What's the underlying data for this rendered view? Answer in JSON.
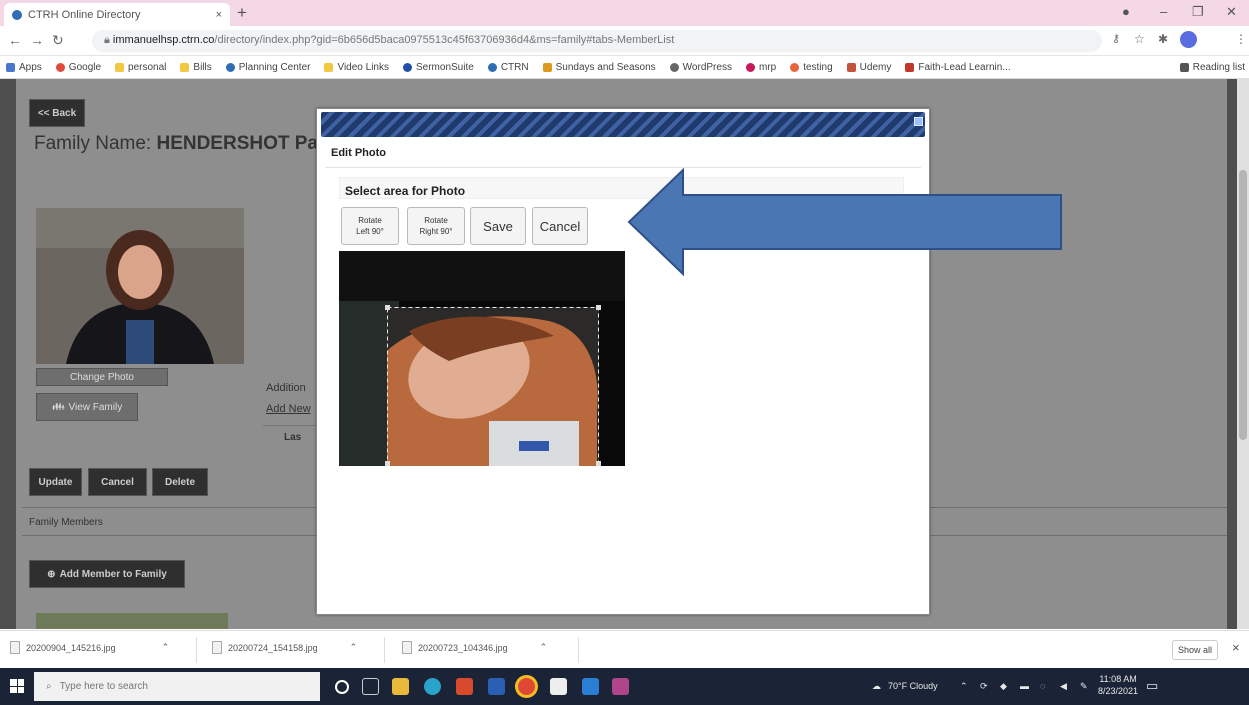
{
  "browser": {
    "tab_title": "CTRH Online Directory",
    "tab_close": "×",
    "new_tab": "+",
    "url_host": "immanuelhsp.ctrn.co",
    "url_path": "/directory/index.php?gid=6b656d5baca0975513c45f63706936d4&ms=family#tabs-MemberList",
    "bookmarks": [
      "Apps",
      "Google",
      "personal",
      "Bills",
      "Planning Center",
      "Video Links",
      "SermonSuite",
      "CTRN",
      "Sundays and Seasons",
      "WordPress",
      "mrp",
      "testing",
      "Udemy",
      "Faith-Lead Learnin..."
    ],
    "reading_list": "Reading list"
  },
  "page": {
    "back_label": "<< Back",
    "family_name_label": "Family Name:",
    "family_name_value": "HENDERSHOT Pas",
    "change_photo_label": "Change Photo",
    "view_family_label": "View Family",
    "additional_label": "Addition",
    "add_new_label": "Add New",
    "last_label": "Las",
    "update_label": "Update",
    "cancel_label": "Cancel",
    "delete_label": "Delete",
    "family_members_label": "Family Members",
    "add_member_label": "Add Member to Family"
  },
  "modal": {
    "title": "Edit Photo",
    "crop_title": "Select area for Photo",
    "rotate_left_line1": "Rotate",
    "rotate_left_line2": "Left 90°",
    "rotate_right_line1": "Rotate",
    "rotate_right_line2": "Right 90°",
    "save_label": "Save",
    "cancel_label": "Cancel"
  },
  "downloads": {
    "items": [
      "20200904_145216.jpg",
      "20200724_154158.jpg",
      "20200723_104346.jpg"
    ],
    "show_all": "Show all",
    "close": "×"
  },
  "taskbar": {
    "search_placeholder": "Type here to search",
    "weather": "70°F Cloudy",
    "time": "11:08 AM",
    "date": "8/23/2021"
  },
  "colors": {
    "arrow_fill": "#4a76b4",
    "arrow_stroke": "#2e5088",
    "modal_stripe": "#1f3a6c",
    "page_bg": "#8e8e8e"
  }
}
